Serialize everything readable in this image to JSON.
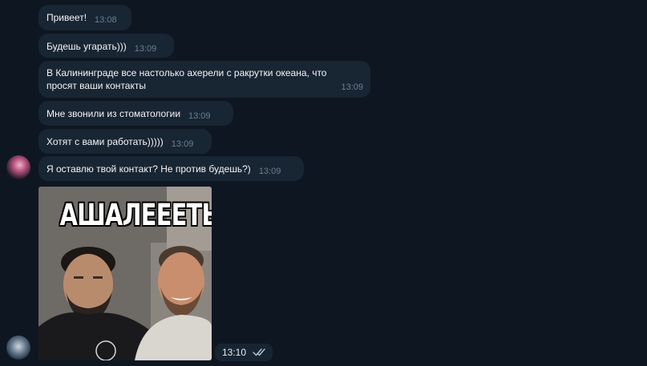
{
  "messages": [
    {
      "text": "Привеет!",
      "time": "13:08"
    },
    {
      "text": "Будешь угарать)))",
      "time": "13:09"
    },
    {
      "text": "В Калининграде все настолько ахерели с ракрутки океана, что\nпросят ваши контакты",
      "time": "13:09"
    },
    {
      "text": "Мне звонили из стоматологии",
      "time": "13:09"
    },
    {
      "text": "Хотят с вами работать)))))",
      "time": "13:09"
    },
    {
      "text": "Я оставлю твой контакт? Не против будешь?)",
      "time": "13:09"
    }
  ],
  "photo_message": {
    "caption": "АШАЛЕЕЕТЬ",
    "time": "13:10",
    "status_icon": "double-check-icon"
  },
  "colors": {
    "background": "#0e1621",
    "bubble": "#182533",
    "time": "#6d7f8f",
    "text": "#f5f5f5"
  }
}
